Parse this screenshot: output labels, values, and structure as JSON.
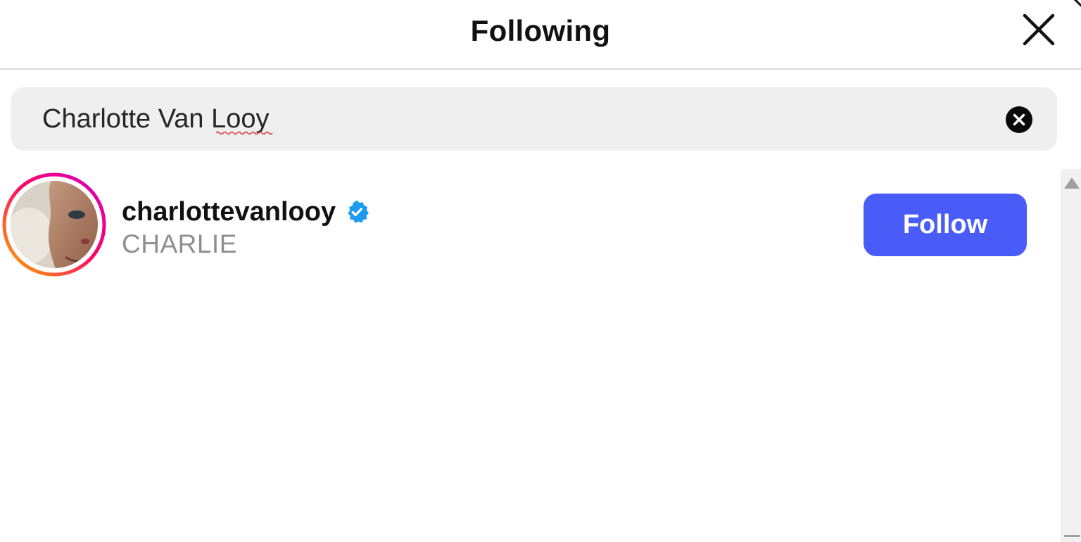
{
  "header": {
    "title": "Following",
    "close_icon": "close-icon"
  },
  "search": {
    "value": "Charlotte Van Looy",
    "clear_icon": "clear-circle-icon"
  },
  "results": [
    {
      "username": "charlottevanlooy",
      "full_name": "CHARLIE",
      "verified": true,
      "verified_icon": "verified-badge-icon",
      "avatar_icon": "profile-photo",
      "action_label": "Follow"
    }
  ],
  "colors": {
    "follow_button": "#4a5cf7",
    "verified_badge": "#1d9bf0",
    "story_ring_start": "#d300c5",
    "story_ring_end": "#ffb000",
    "search_background": "#efefef"
  },
  "scrollbar": {
    "up_icon": "scroll-up-arrow-icon",
    "down_icon": "scroll-down-arrow-icon"
  }
}
